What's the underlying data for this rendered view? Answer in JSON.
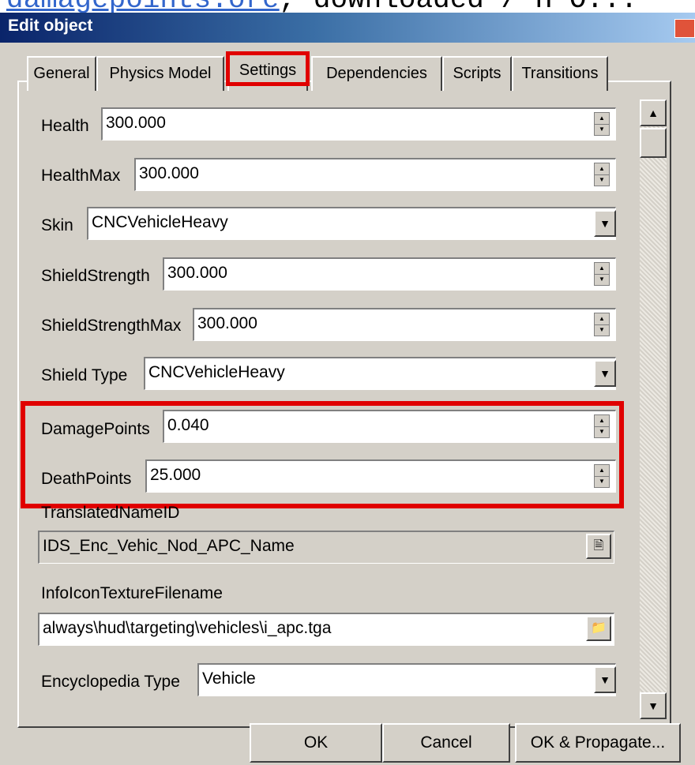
{
  "page_top_text": {
    "link": "damagepoints.ore",
    "rest": ", downloaded / H O..."
  },
  "window": {
    "title": "Edit object",
    "close_glyph": "✕"
  },
  "tabs": [
    {
      "label": "General"
    },
    {
      "label": "Physics Model"
    },
    {
      "label": "Settings",
      "active": true
    },
    {
      "label": "Dependencies"
    },
    {
      "label": "Scripts"
    },
    {
      "label": "Transitions"
    }
  ],
  "fields": {
    "health": {
      "label": "Health",
      "value": "300.000"
    },
    "health_max": {
      "label": "HealthMax",
      "value": "300.000"
    },
    "skin": {
      "label": "Skin",
      "value": "CNCVehicleHeavy"
    },
    "shield_strength": {
      "label": "ShieldStrength",
      "value": "300.000"
    },
    "shield_strength_max": {
      "label": "ShieldStrengthMax",
      "value": "300.000"
    },
    "shield_type": {
      "label": "Shield Type",
      "value": "CNCVehicleHeavy"
    },
    "damage_points": {
      "label": "DamagePoints",
      "value": "0.040"
    },
    "death_points": {
      "label": "DeathPoints",
      "value": "25.000"
    },
    "translated_name_id": {
      "label": "TranslatedNameID",
      "value": "IDS_Enc_Vehic_Nod_APC_Name"
    },
    "info_icon_texture": {
      "label": "InfoIconTextureFilename",
      "value": "always\\hud\\targeting\\vehicles\\i_apc.tga"
    },
    "encyclopedia_type": {
      "label": "Encyclopedia Type",
      "value": "Vehicle"
    }
  },
  "buttons": {
    "ok": "OK",
    "cancel": "Cancel",
    "ok_propagate": "OK & Propagate..."
  },
  "icons": {
    "spinner_up": "▲",
    "spinner_down": "▼",
    "dropdown": "▼",
    "scroll_up": "▲",
    "scroll_down": "▼",
    "note": "🗎",
    "folder": "📁"
  },
  "colors": {
    "highlight": "#e00000",
    "titlebar": "#0a246a",
    "dialog_bg": "#d4d0c8"
  }
}
